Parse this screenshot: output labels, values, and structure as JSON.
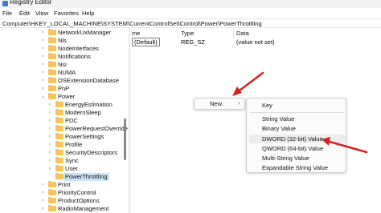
{
  "window": {
    "title": "Registry Editor"
  },
  "menubar": {
    "items": [
      "File",
      "Edit",
      "View",
      "Favorites",
      "Help"
    ]
  },
  "address": {
    "path": "Computer\\HKEY_LOCAL_MACHINE\\SYSTEM\\CurrentControlSet\\Control\\Power\\PowerThrottling"
  },
  "tree": {
    "items": [
      {
        "label": "NetworkUxManager",
        "expanded": false,
        "depth": 0,
        "selected": false
      },
      {
        "label": "Nls",
        "expanded": false,
        "depth": 0,
        "selected": false
      },
      {
        "label": "NodeInterfaces",
        "expanded": false,
        "depth": 0,
        "selected": false
      },
      {
        "label": "Notifications",
        "expanded": false,
        "depth": 0,
        "selected": false
      },
      {
        "label": "Nsi",
        "expanded": false,
        "depth": 0,
        "selected": false
      },
      {
        "label": "NUMA",
        "expanded": false,
        "depth": 0,
        "selected": false
      },
      {
        "label": "OSExtensionDatabase",
        "expanded": false,
        "depth": 0,
        "selected": false
      },
      {
        "label": "PnP",
        "expanded": false,
        "depth": 0,
        "selected": false
      },
      {
        "label": "Power",
        "expanded": true,
        "depth": 0,
        "selected": false
      },
      {
        "label": "EnergyEstimation",
        "expanded": false,
        "depth": 1,
        "selected": false
      },
      {
        "label": "ModernSleep",
        "expanded": false,
        "depth": 1,
        "selected": false
      },
      {
        "label": "PDC",
        "expanded": false,
        "depth": 1,
        "selected": false
      },
      {
        "label": "PowerRequestOverride",
        "expanded": false,
        "depth": 1,
        "selected": false
      },
      {
        "label": "PowerSettings",
        "expanded": false,
        "depth": 1,
        "selected": false
      },
      {
        "label": "Profile",
        "expanded": false,
        "depth": 1,
        "selected": false
      },
      {
        "label": "SecurityDescriptors",
        "expanded": false,
        "depth": 1,
        "selected": false
      },
      {
        "label": "Sync",
        "expanded": false,
        "depth": 1,
        "selected": false
      },
      {
        "label": "User",
        "expanded": false,
        "depth": 1,
        "selected": false
      },
      {
        "label": "PowerThrottling",
        "expanded": false,
        "depth": 1,
        "selected": true
      },
      {
        "label": "Print",
        "expanded": false,
        "depth": 0,
        "selected": false
      },
      {
        "label": "PriorityControl",
        "expanded": false,
        "depth": 0,
        "selected": false
      },
      {
        "label": "ProductOptions",
        "expanded": false,
        "depth": 0,
        "selected": false
      },
      {
        "label": "RadioManagement",
        "expanded": false,
        "depth": 0,
        "selected": false
      }
    ]
  },
  "values_pane": {
    "columns": {
      "name": "me",
      "type": "Type",
      "data": "Data"
    },
    "rows": [
      {
        "name": "(Default)",
        "type": "REG_SZ",
        "data": "(value not set)"
      }
    ]
  },
  "context_menu": {
    "item": "New",
    "arrow": "›"
  },
  "submenu": {
    "items": [
      "Key",
      "String Value",
      "Binary Value",
      "DWORD (32-bit) Value",
      "QWORD (64-bit) Value",
      "Multi-String Value",
      "Expandable String Value"
    ],
    "highlighted": "DWORD (32-bit) Value"
  },
  "colors": {
    "arrow": "#d62020",
    "folder": "#f4c55b",
    "selection": "#cce4f7"
  }
}
